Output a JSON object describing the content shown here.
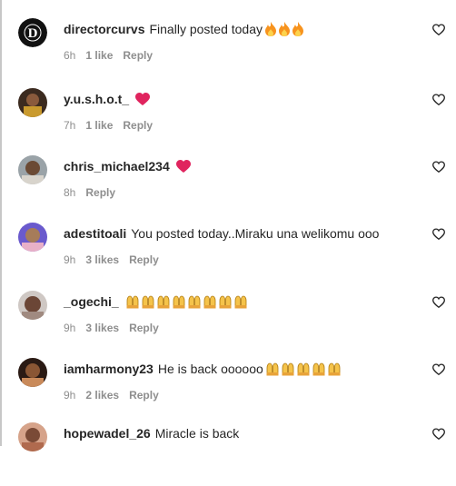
{
  "comments": [
    {
      "username": "directorcurvs",
      "text": "Finally posted today",
      "emoji": "fire",
      "emoji_count": 3,
      "time": "6h",
      "likes": "1 like",
      "reply": "Reply"
    },
    {
      "username": "y.u.s.h.o.t_",
      "text": "",
      "emoji": "red-heart",
      "emoji_count": 1,
      "time": "7h",
      "likes": "1 like",
      "reply": "Reply"
    },
    {
      "username": "chris_michael234",
      "text": "",
      "emoji": "red-heart",
      "emoji_count": 1,
      "time": "8h",
      "likes": "",
      "reply": "Reply"
    },
    {
      "username": "adestitoali",
      "text": "You posted today..Miraku una welikomu ooo",
      "emoji": "",
      "emoji_count": 0,
      "time": "9h",
      "likes": "3 likes",
      "reply": "Reply"
    },
    {
      "username": "_ogechi_",
      "text": "",
      "emoji": "raising-hands",
      "emoji_count": 8,
      "time": "9h",
      "likes": "3 likes",
      "reply": "Reply"
    },
    {
      "username": "iamharmony23",
      "text": "He is back oooooo",
      "emoji": "raising-hands",
      "emoji_count": 5,
      "time": "9h",
      "likes": "2 likes",
      "reply": "Reply"
    },
    {
      "username": "hopewadel_26",
      "text": "Miracle is back",
      "emoji": "",
      "emoji_count": 0,
      "time": "",
      "likes": "",
      "reply": ""
    }
  ],
  "colors": {
    "text": "#262626",
    "meta": "#8e8e8e",
    "heart": "#ed4956",
    "fire": "#f7931e"
  },
  "icons": {
    "like": "heart-outline-icon"
  }
}
